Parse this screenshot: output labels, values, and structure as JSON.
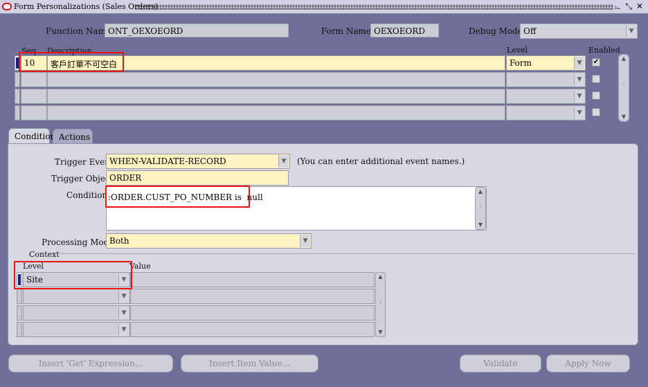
{
  "window": {
    "title": "Form Personalizations (Sales Orders)",
    "controls": {
      "resize": "⌳",
      "restore": "⤡",
      "close": "✕"
    }
  },
  "header": {
    "function_name_label": "Function Name",
    "function_name_value": "ONT_OEXOEORD",
    "form_name_label": "Form Name",
    "form_name_value": "OEXOEORD",
    "debug_mode_label": "Debug Mode",
    "debug_mode_value": "Off"
  },
  "rules_table": {
    "headers": {
      "seq": "Seq",
      "description": "Description",
      "level": "Level",
      "enabled": "Enabled"
    },
    "rows": [
      {
        "seq": "10",
        "description": "客戶訂單不可空白",
        "level": "Form",
        "enabled": "✔"
      },
      {
        "seq": "",
        "description": "",
        "level": "",
        "enabled": ""
      },
      {
        "seq": "",
        "description": "",
        "level": "",
        "enabled": ""
      },
      {
        "seq": "",
        "description": "",
        "level": "",
        "enabled": ""
      }
    ]
  },
  "tabs": [
    {
      "label": "Condition",
      "active": true
    },
    {
      "label": "Actions",
      "active": false
    }
  ],
  "condition": {
    "trigger_event_label": "Trigger Event",
    "trigger_event_value": "WHEN-VALIDATE-RECORD",
    "trigger_event_hint": "(You can enter additional event names.)",
    "trigger_object_label": "Trigger Object",
    "trigger_object_value": "ORDER",
    "condition_label": "Condition",
    "condition_value": ":ORDER.CUST_PO_NUMBER is  null",
    "processing_mode_label": "Processing Mode",
    "processing_mode_value": "Both"
  },
  "context": {
    "section_label": "Context",
    "headers": {
      "level": "Level",
      "value": "Value"
    },
    "rows": [
      {
        "level": "Site",
        "value": ""
      },
      {
        "level": "",
        "value": ""
      },
      {
        "level": "",
        "value": ""
      },
      {
        "level": "",
        "value": ""
      }
    ]
  },
  "buttons": {
    "insert_get_expression": "Insert 'Get' Expression...",
    "insert_item_value": "Insert Item Value...",
    "validate": "Validate",
    "apply_now": "Apply Now"
  },
  "colors": {
    "background": "#6e6e98",
    "required_field": "#fff3c2",
    "highlight_box": "#ee1111"
  }
}
